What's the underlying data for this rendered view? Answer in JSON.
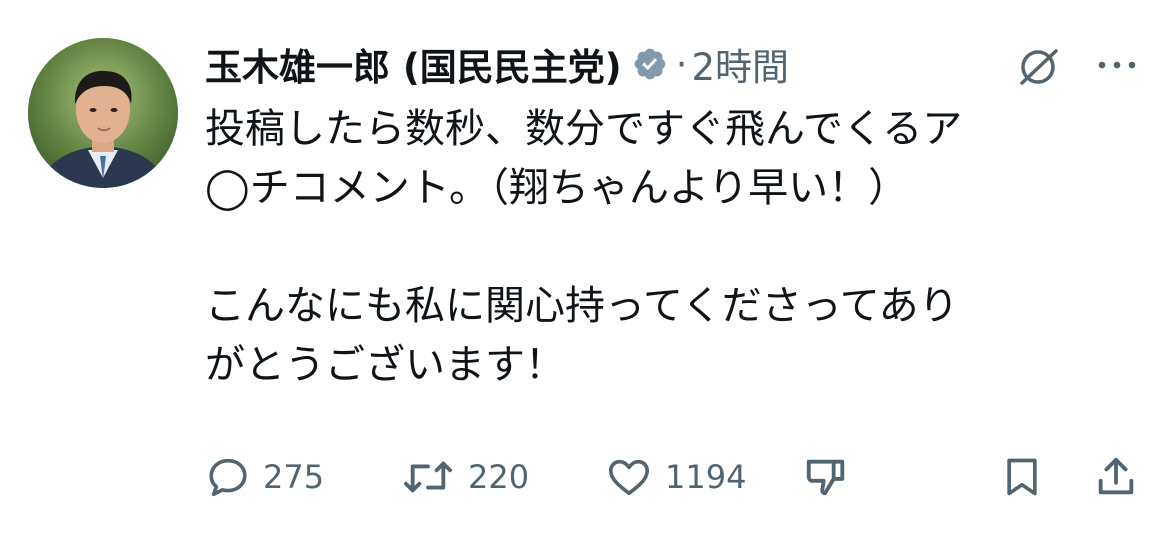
{
  "author": {
    "name": "玉木雄一郎 (国民民主党)",
    "verified": true,
    "avatar_alt": "avatar"
  },
  "meta": {
    "separator": "·",
    "time": "2時間"
  },
  "icons": {
    "verified": "verified-badge-icon",
    "grok": "grok-icon",
    "more": "more-icon",
    "reply": "reply-icon",
    "retweet": "retweet-icon",
    "like": "like-icon",
    "dislike": "thumbs-down-icon",
    "bookmark": "bookmark-icon",
    "share": "share-icon"
  },
  "colors": {
    "text": "#0f1419",
    "secondary": "#536471",
    "verified": "#829aab"
  },
  "post": {
    "text": "投稿したら数秒、数分ですぐ飛んでくるア\n◯チコメント。（翔ちゃんより早い！）\n\nこんなにも私に関心持ってくださってあり\nがとうございます！"
  },
  "actions": {
    "replies": "275",
    "retweets": "220",
    "likes": "1194"
  }
}
